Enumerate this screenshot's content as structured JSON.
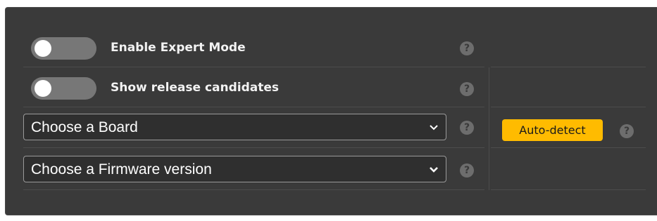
{
  "options": {
    "expert_mode": {
      "label": "Enable Expert Mode",
      "enabled": false
    },
    "release_candidates": {
      "label": "Show release candidates",
      "enabled": false
    }
  },
  "board_select": {
    "selected": "Choose a Board"
  },
  "firmware_select": {
    "selected": "Choose a Firmware version"
  },
  "auto_detect": {
    "label": "Auto-detect"
  },
  "help": {
    "glyph": "?"
  },
  "colors": {
    "panel": "#3a3a3a",
    "toggle_off": "#777777",
    "accent": "#ffbb00"
  }
}
